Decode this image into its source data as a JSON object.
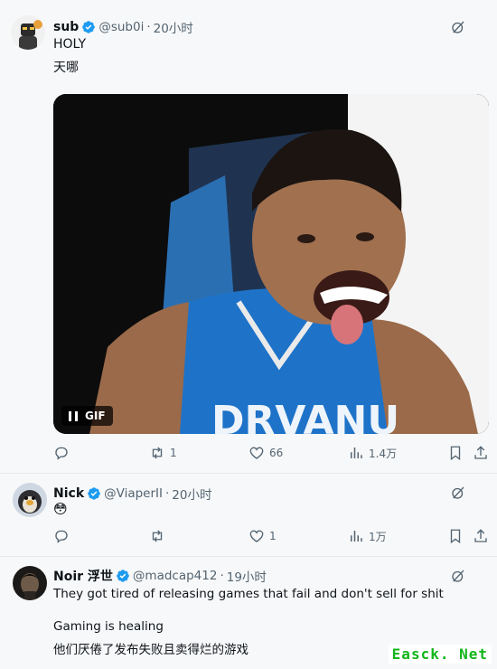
{
  "tweets": [
    {
      "name": "sub",
      "handle": "@sub0i",
      "time": "20小时",
      "text_lines": [
        "HOLY",
        "天哪"
      ],
      "media_badge": "GIF",
      "actions": {
        "reply": "",
        "retweet": "1",
        "like": "66",
        "views": "1.4万"
      }
    },
    {
      "name": "Nick",
      "handle": "@ViaperII",
      "time": "20小时",
      "text_lines": [
        "😳"
      ],
      "actions": {
        "reply": "",
        "retweet": "",
        "like": "1",
        "views": "1万"
      }
    },
    {
      "name": "Noir 浮世",
      "handle": "@madcap412",
      "time": "19小时",
      "text_lines": [
        "They got tired of releasing games that fail and don't sell for shit",
        "Gaming is healing",
        "他们厌倦了发布失败且卖得烂的游戏"
      ]
    }
  ],
  "dot": "·",
  "watermark": "Easck. Net",
  "colors": {
    "verified": "#1d9bf0",
    "muted": "#536471",
    "watermark": "#10b61a"
  },
  "icons": [
    "verified-badge-icon",
    "grok-icon",
    "reply-icon",
    "retweet-icon",
    "like-icon",
    "views-icon",
    "bookmark-icon",
    "share-icon",
    "pause-icon"
  ]
}
